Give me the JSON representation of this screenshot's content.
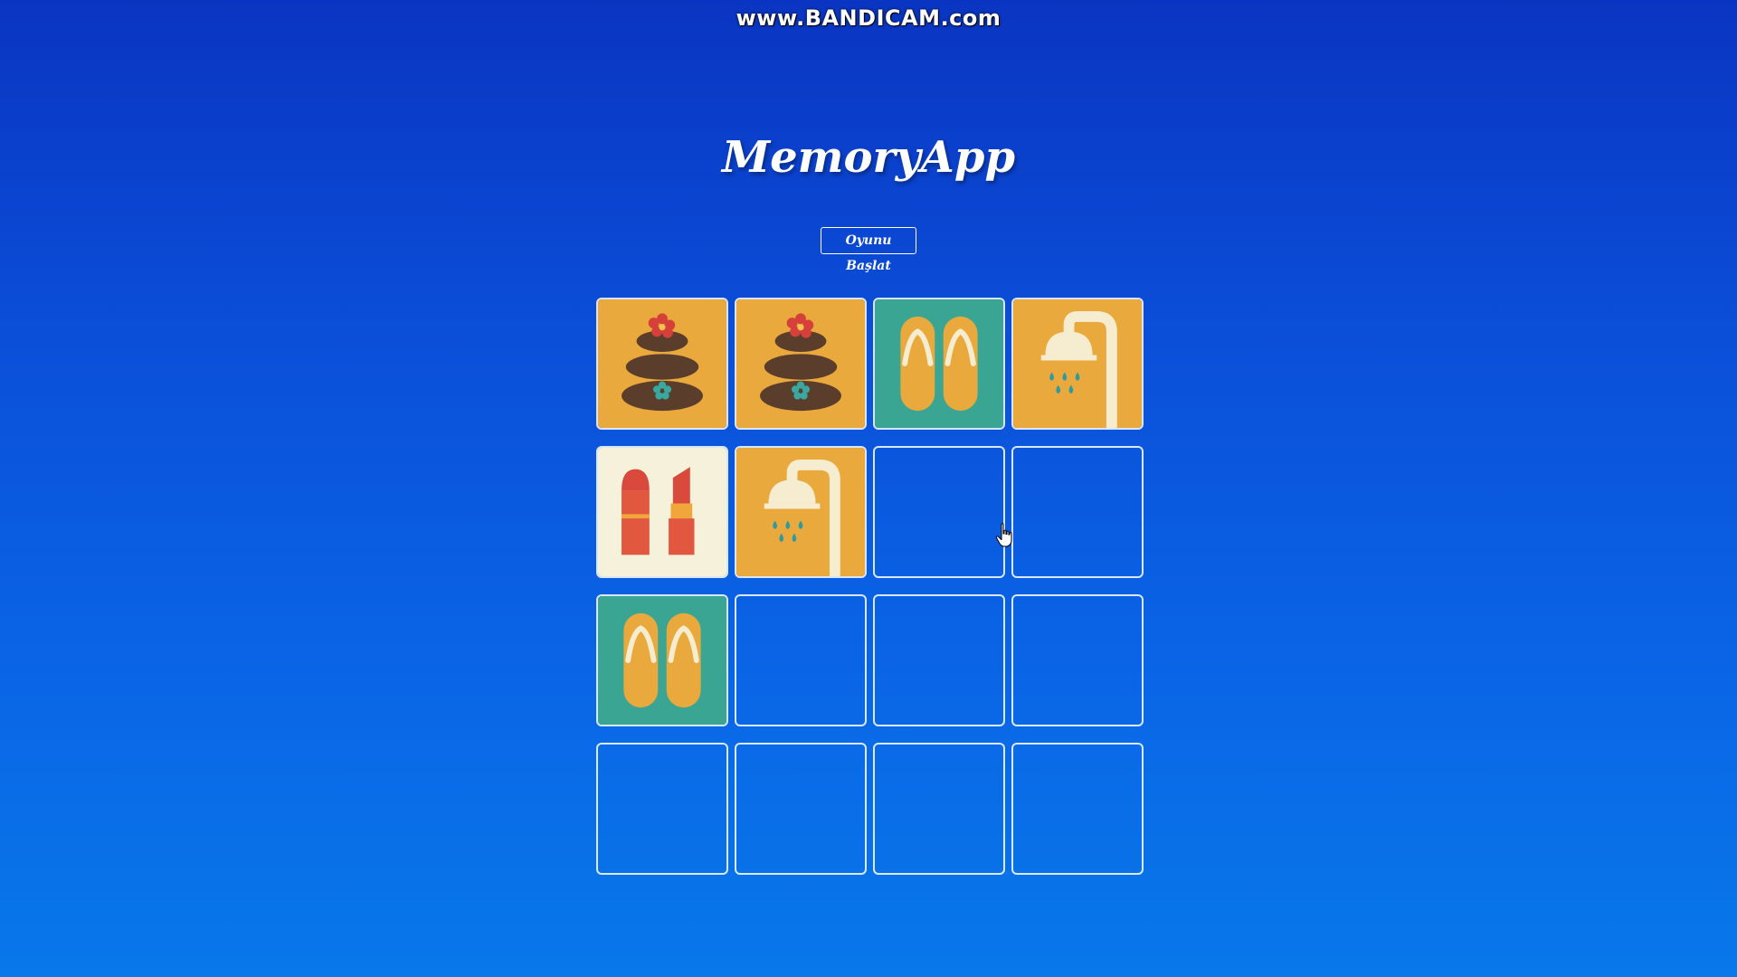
{
  "watermark": "www.BANDICAM.com",
  "title": "MemoryApp",
  "start_button": "Oyunu Başlat",
  "colors": {
    "background_top": "#0a35c2",
    "background_bottom": "#0878ea",
    "card_orange": "#eaa93c",
    "card_teal": "#3aa592",
    "card_cream": "#f6f1da"
  },
  "cards": [
    {
      "state": "face-up",
      "icon": "spa-stones-icon"
    },
    {
      "state": "face-up",
      "icon": "spa-stones-icon"
    },
    {
      "state": "face-up",
      "icon": "flip-flops-icon"
    },
    {
      "state": "face-up",
      "icon": "shower-icon"
    },
    {
      "state": "face-up",
      "icon": "lipstick-icon"
    },
    {
      "state": "face-up",
      "icon": "shower-icon"
    },
    {
      "state": "face-down",
      "icon": ""
    },
    {
      "state": "face-down",
      "icon": ""
    },
    {
      "state": "face-up",
      "icon": "flip-flops-icon"
    },
    {
      "state": "face-down",
      "icon": ""
    },
    {
      "state": "face-down",
      "icon": ""
    },
    {
      "state": "face-down",
      "icon": ""
    },
    {
      "state": "face-down",
      "icon": ""
    },
    {
      "state": "face-down",
      "icon": ""
    },
    {
      "state": "face-down",
      "icon": ""
    },
    {
      "state": "face-down",
      "icon": ""
    }
  ]
}
